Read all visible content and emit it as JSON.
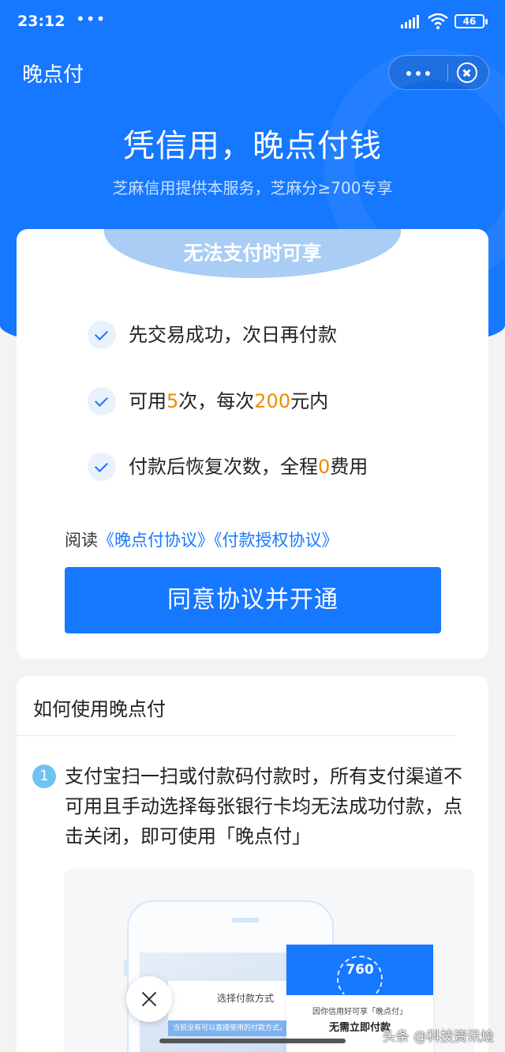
{
  "status_bar": {
    "time": "23:12",
    "dots": "•••",
    "battery": "46"
  },
  "app": {
    "title": "晚点付"
  },
  "hero": {
    "title": "凭信用，晚点付钱",
    "subtitle": "芝麻信用提供本服务，芝麻分≥700专享"
  },
  "card": {
    "banner": "无法支付时可享",
    "features": [
      {
        "text": "先交易成功，次日再付款"
      },
      {
        "prefix": "可用",
        "count": "5",
        "mid": "次，每次",
        "amount": "200",
        "suffix": "元内"
      },
      {
        "prefix": "付款后恢复次数，全程",
        "fee": "0",
        "suffix": "费用"
      }
    ],
    "agreement": {
      "prefix": "阅读",
      "link1": "《晚点付协议》",
      "link2": "《付款授权协议》"
    },
    "cta": "同意协议并开通"
  },
  "how": {
    "title": "如何使用晚点付",
    "step_number": "1",
    "step_text": "支付宝扫一扫或付款码付款时，所有支付渠道不可用且手动选择每张银行卡均无法成功付款，点击关闭，即可使用「晚点付」",
    "illustration": {
      "sheet_title": "选择付款方式",
      "sheet_note": "当前没有可以直接使用的付款方式，",
      "score": "760",
      "popup_line1": "因你信用好可享「晚点付」",
      "popup_line2": "无需立即付款"
    }
  },
  "watermark": "头条 @科技资讯烩",
  "colors": {
    "brand": "#1677ff",
    "highlight": "#f08a00",
    "banner": "#a9cdf4"
  }
}
